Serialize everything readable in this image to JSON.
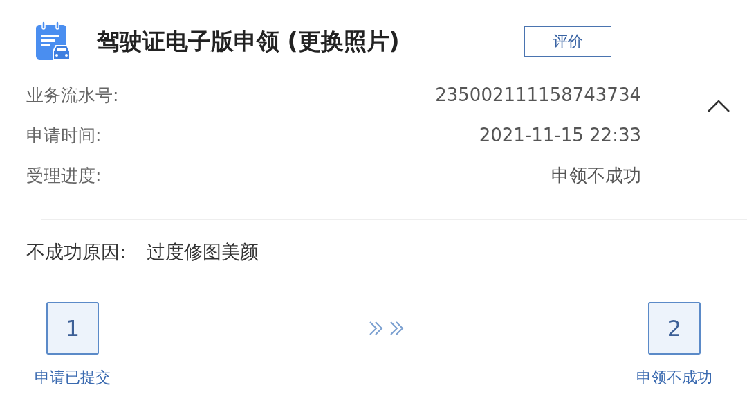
{
  "header": {
    "title": "驾驶证电子版申领 (更换照片)",
    "rate_button": "评价"
  },
  "details": {
    "expanded": true,
    "rows": [
      {
        "label": "业务流水号:",
        "value": "235002111158743734"
      },
      {
        "label": "申请时间:",
        "value": "2021-11-15 22:33"
      },
      {
        "label": "受理进度:",
        "value": "申领不成功"
      }
    ]
  },
  "reason": {
    "label": "不成功原因:",
    "value": "过度修图美颜"
  },
  "steps": [
    {
      "number": "1",
      "label": "申请已提交"
    },
    {
      "number": "2",
      "label": "申领不成功"
    }
  ]
}
